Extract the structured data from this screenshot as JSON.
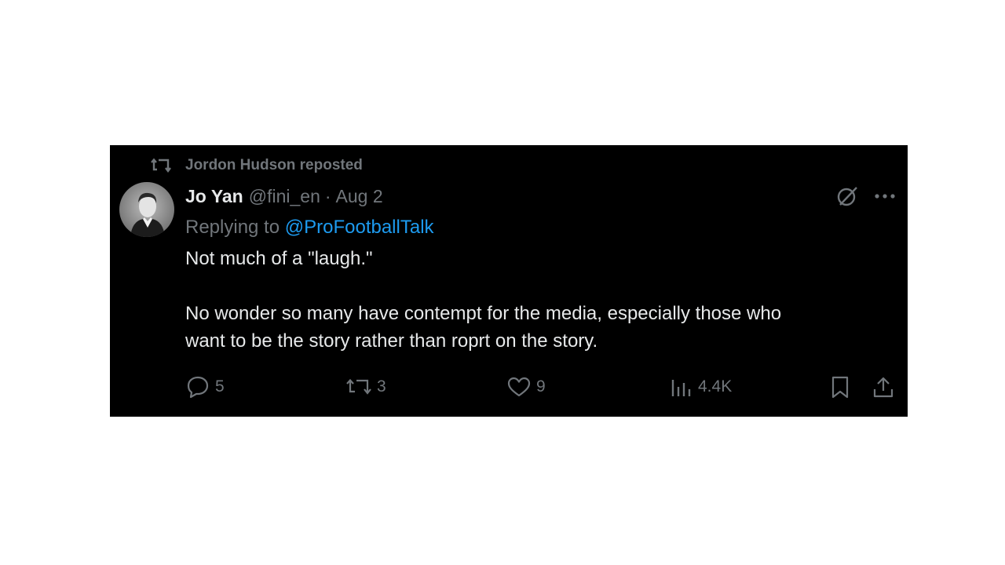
{
  "repost": {
    "label": "Jordon Hudson reposted",
    "icon": "repost-icon"
  },
  "tweet": {
    "display_name": "Jo Yan",
    "handle": "@fini_en",
    "separator": "·",
    "date": "Aug 2",
    "reply_prefix": "Replying to",
    "reply_to": "@ProFootballTalk",
    "text": "Not much of a \"laugh.\"\n\nNo wonder so many have contempt for the media, especially those who\nwant to be the story rather than roprt on the story."
  },
  "header_icons": [
    "grok-icon",
    "more-icon"
  ],
  "actions": {
    "replies": "5",
    "reposts": "3",
    "likes": "9",
    "views": "4.4K"
  },
  "colors": {
    "background": "#000000",
    "text": "#e7e9ea",
    "muted": "#71767b",
    "link": "#1d9bf0"
  }
}
